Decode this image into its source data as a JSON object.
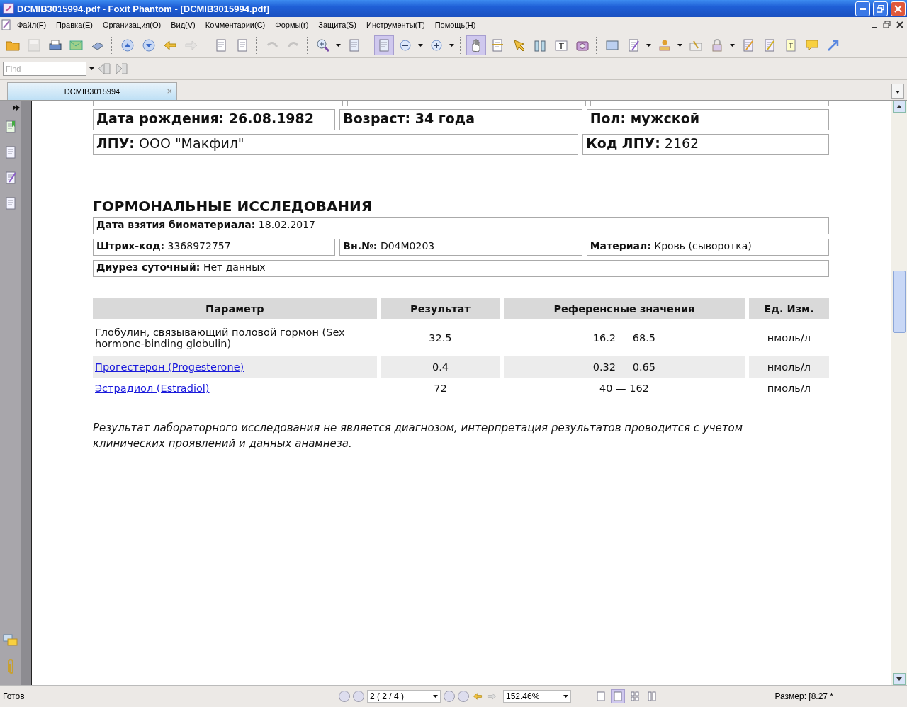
{
  "window": {
    "title": "DCMIB3015994.pdf - Foxit Phantom - [DCMIB3015994.pdf]"
  },
  "menu": [
    "Файл(F)",
    "Правка(E)",
    "Организация(O)",
    "Вид(V)",
    "Комментарии(C)",
    "Формы(r)",
    "Защита(S)",
    "Инструменты(T)",
    "Помощь(H)"
  ],
  "toolbar": [
    {
      "selected": false,
      "disabled": false,
      "dropdown": false
    },
    {
      "selected": false,
      "disabled": true,
      "dropdown": false
    },
    {
      "selected": false,
      "disabled": false,
      "dropdown": false
    },
    {
      "selected": false,
      "disabled": false,
      "dropdown": false
    },
    {
      "selected": false,
      "disabled": false,
      "dropdown": false
    },
    {
      "selected": false,
      "disabled": false,
      "dropdown": false
    },
    {
      "selected": false,
      "disabled": false,
      "dropdown": false
    },
    {
      "selected": false,
      "disabled": false,
      "dropdown": false
    },
    {
      "selected": false,
      "disabled": true,
      "dropdown": false
    },
    {
      "selected": false,
      "disabled": false,
      "dropdown": false
    },
    {
      "selected": false,
      "disabled": false,
      "dropdown": false
    },
    {
      "selected": false,
      "disabled": true,
      "dropdown": false
    },
    {
      "selected": false,
      "disabled": true,
      "dropdown": false
    },
    {
      "selected": false,
      "disabled": false,
      "dropdown": true
    },
    {
      "selected": false,
      "disabled": false,
      "dropdown": false
    },
    {
      "selected": true,
      "disabled": false,
      "dropdown": false
    },
    {
      "selected": false,
      "disabled": false,
      "dropdown": true
    },
    {
      "selected": false,
      "disabled": false,
      "dropdown": true
    },
    {
      "selected": true,
      "disabled": false,
      "dropdown": false
    },
    {
      "selected": false,
      "disabled": false,
      "dropdown": false
    },
    {
      "selected": false,
      "disabled": false,
      "dropdown": false
    },
    {
      "selected": false,
      "disabled": false,
      "dropdown": false
    },
    {
      "selected": false,
      "disabled": false,
      "dropdown": false
    },
    {
      "selected": false,
      "disabled": false,
      "dropdown": false
    },
    {
      "selected": false,
      "disabled": false,
      "dropdown": false
    },
    {
      "selected": false,
      "disabled": false,
      "dropdown": true
    },
    {
      "selected": false,
      "disabled": false,
      "dropdown": true
    },
    {
      "selected": false,
      "disabled": false,
      "dropdown": false
    },
    {
      "selected": false,
      "disabled": false,
      "dropdown": true
    },
    {
      "selected": false,
      "disabled": false,
      "dropdown": false
    },
    {
      "selected": false,
      "disabled": false,
      "dropdown": false
    },
    {
      "selected": false,
      "disabled": false,
      "dropdown": false
    },
    {
      "selected": false,
      "disabled": false,
      "dropdown": false
    },
    {
      "selected": false,
      "disabled": false,
      "dropdown": false
    }
  ],
  "find": {
    "placeholder": "Find"
  },
  "tabs": [
    {
      "label": "DCMIB3015994",
      "selected": true,
      "close": "×"
    }
  ],
  "document": {
    "patient_rows": [
      [
        {
          "text": "Дата рождения: 26.08.1982"
        },
        {
          "text": "Возраст: 34 года"
        },
        {
          "text": "Пол: мужской"
        }
      ],
      [
        {
          "text": "**ЛПУ:** ООО \"Макфил\""
        },
        {
          "text": "**Код ЛПУ:** 2162"
        }
      ]
    ],
    "heading": "ГОРМОНАЛЬНЫЕ ИССЛЕДОВАНИЯ",
    "info_rows": [
      [
        {
          "text": "**Дата взятия биоматериала:** 18.02.2017"
        }
      ],
      [
        {
          "text": "**Штрих-код:** 3368972757"
        },
        {
          "text": "**Вн.№:** D04M0203"
        },
        {
          "text": "**Материал:** Кровь (сыворотка)"
        }
      ],
      [
        {
          "text": "**Диурез суточный:**  Нет данных"
        }
      ]
    ],
    "table": {
      "columns": [
        "Параметр",
        "Результат",
        "Референсные значения",
        "Ед. Изм."
      ],
      "rows": [
        {
          "shaded": false,
          "link": false,
          "cells": [
            "Глобулин, связывающий половой гормон (Sex hormone-binding globulin)",
            "32.5",
            "16.2 — 68.5",
            "нмоль/л"
          ]
        },
        {
          "shaded": true,
          "link": true,
          "cells": [
            "Прогестерон (Progesterone)",
            "0.4",
            "0.32 — 0.65",
            "нмоль/л"
          ]
        },
        {
          "shaded": false,
          "link": true,
          "cells": [
            "Эстрадиол (Estradiol)",
            "72",
            "40 — 162",
            "пмоль/л"
          ]
        }
      ]
    },
    "note": "Результат лабораторного исследования не является диагнозом, интерпретация результатов проводится с учетом клинических проявлений и данных анамнеза."
  },
  "status_bar": {
    "status": "Готов",
    "page": "2 ( 2 / 4 )",
    "zoom": "152.46%",
    "view_modes": [
      {
        "selected": false
      },
      {
        "selected": true
      },
      {
        "selected": false
      },
      {
        "selected": false
      }
    ],
    "size": "Размер: [8.27 *"
  }
}
